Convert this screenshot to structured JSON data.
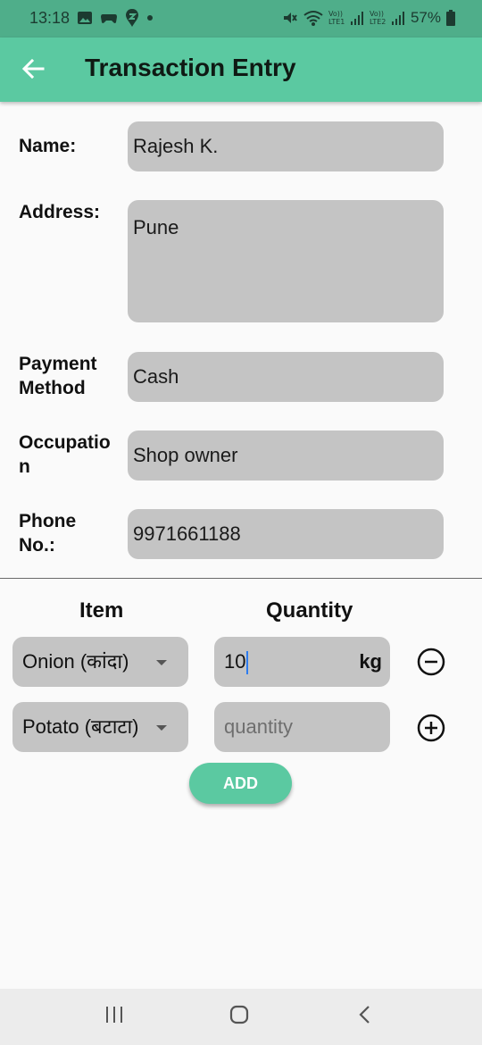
{
  "status_bar": {
    "time": "13:18",
    "battery": "57%",
    "icons_left": [
      "gallery-icon",
      "game-icon",
      "swiggy-icon",
      "dot-icon"
    ],
    "icons_right": [
      "mute-icon",
      "wifi-icon",
      "volte-lte1-signal-icon",
      "volte-lte2-signal-icon",
      "battery-icon"
    ]
  },
  "app_bar": {
    "title": "Transaction Entry",
    "back_icon": "arrow-back-icon"
  },
  "form": {
    "name_label": "Name:",
    "name_value": "Rajesh K.",
    "address_label": "Address:",
    "address_value": "Pune",
    "payment_label_1": "Payment",
    "payment_label_2": "Method",
    "payment_value": "Cash",
    "occupation_label": "Occupation",
    "occupation_value": "Shop owner",
    "phone_label_1": "Phone",
    "phone_label_2": "No.:",
    "phone_value": "9971661188"
  },
  "items_table": {
    "item_header": "Item",
    "quantity_header": "Quantity",
    "rows": [
      {
        "item": "Onion (कांदा)",
        "quantity": "10",
        "unit": "kg",
        "action_icon": "minus-circle-icon"
      },
      {
        "item": "Potato (बटाटा)",
        "quantity_placeholder": "quantity",
        "action_icon": "plus-circle-icon"
      }
    ]
  },
  "add_button": "ADD",
  "nav_bar": [
    "recent-apps-icon",
    "home-icon",
    "back-icon"
  ],
  "colors": {
    "status_bar": "#4fae8a",
    "app_bar": "#5bc9a1",
    "field_bg": "#c4c4c4",
    "cursor": "#2d7cf0"
  }
}
